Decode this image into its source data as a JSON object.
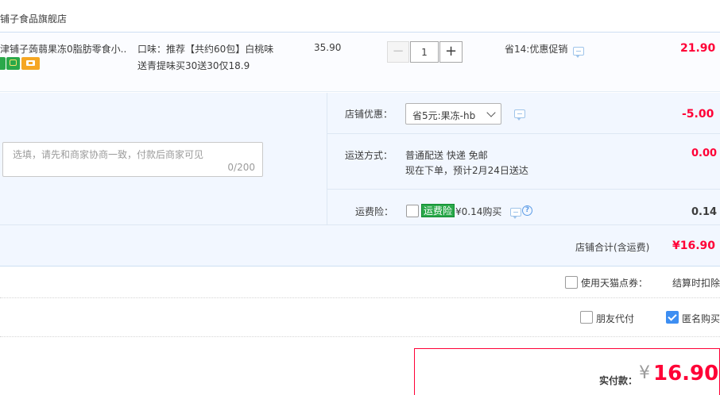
{
  "store": {
    "name": "铺子食品旗舰店"
  },
  "item": {
    "title": "津铺子蒟蒻果冻0脂肪零食小...",
    "sku_attr": "口味：推荐【共约60包】白桃味",
    "sku_promo": "送青提味买30送30仅18.9",
    "unit_price": "35.90",
    "quantity": "1",
    "minus_label": "−",
    "plus_label": "+",
    "promo": "省14:优惠促销",
    "total": "21.90",
    "badge_icons": [
      "green-tag-icon",
      "gift-icon",
      "card-icon"
    ]
  },
  "shop": {
    "coupon_label": "店铺优惠：",
    "coupon_selected": "省5元:果冻-hb",
    "coupon_amount": "-5.00",
    "shipping_label": "运送方式：",
    "shipping_method": "普通配送 快递 免邮",
    "shipping_eta": "现在下单，预计2月24日送达",
    "shipping_amount": "0.00",
    "insurance_label": "运费险：",
    "insurance_tag": "运费险",
    "insurance_price": "¥0.14购买",
    "insurance_amount": "0.14",
    "help_glyph": "?",
    "memo_placeholder": "选填，请先和商家协商一致，付款后商家可见",
    "memo_count": "0/200",
    "total_label": "店铺合计(含运费)",
    "total_amount": "¥16.90"
  },
  "options": {
    "points_label": "使用天猫点券：",
    "points_note": "结算时扣除",
    "friend_pay_label": "朋友代付",
    "anonymous_label": "匿名购买",
    "anonymous_checked": true,
    "friend_pay_checked": false,
    "points_checked": false
  },
  "payment": {
    "label": "实付款：",
    "currency": "¥",
    "amount": "16.90"
  },
  "colors": {
    "price_red": "#ff0036",
    "panel_bg": "#f2f7ff",
    "accent_blue": "#3d8ef2",
    "tag_green": "#2aa84a"
  }
}
